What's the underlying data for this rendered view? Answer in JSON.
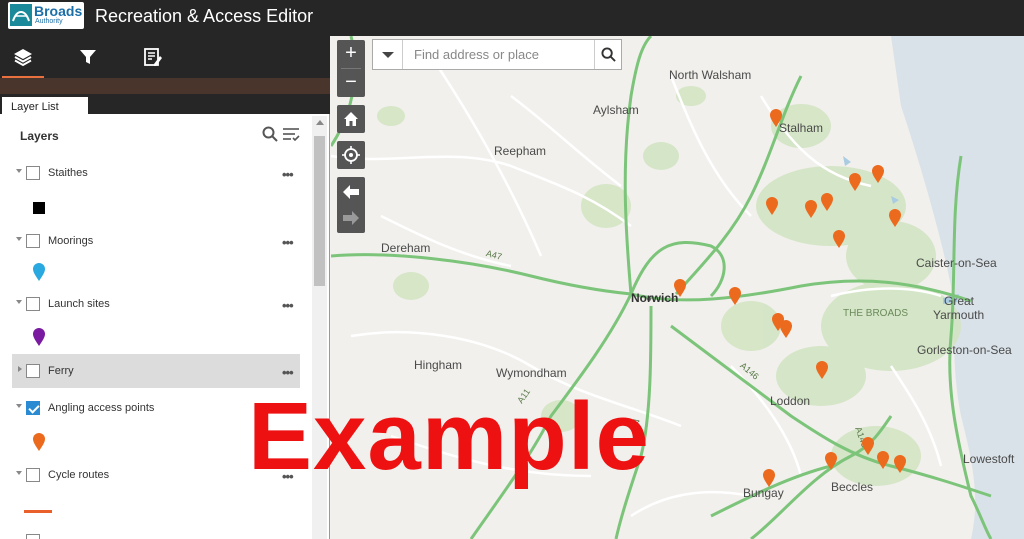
{
  "header": {
    "logo_word": "Broads",
    "logo_sub": "Authority",
    "title": "Recreation & Access Editor"
  },
  "toolbar": {
    "tools": [
      "layers-icon",
      "filter-icon",
      "edit-icon"
    ],
    "active": "layers-icon"
  },
  "panel": {
    "tab_label": "Layer List",
    "heading": "Layers",
    "layers": [
      {
        "label": "Staithes",
        "checked": false,
        "legend": "black-square"
      },
      {
        "label": "Moorings",
        "checked": false,
        "legend": "blue-pin"
      },
      {
        "label": "Launch sites",
        "checked": false,
        "legend": "purple-pin"
      },
      {
        "label": "Ferry",
        "checked": false,
        "legend": "none"
      },
      {
        "label": "Angling access points",
        "checked": true,
        "legend": "orange-pin"
      },
      {
        "label": "Cycle routes",
        "checked": false,
        "legend": "orange-line"
      }
    ]
  },
  "search": {
    "placeholder": "Find address or place"
  },
  "map": {
    "controls": [
      "zoom-in",
      "zoom-out",
      "home",
      "locate",
      "back",
      "forward"
    ],
    "zoom_in_label": "+",
    "zoom_out_label": "−",
    "places": {
      "north_walsham": "North Walsham",
      "aylsham": "Aylsham",
      "stalham": "Stalham",
      "reepham": "Reepham",
      "dereham": "Dereham",
      "caister": "Caister-on-Sea",
      "norwich": "Norwich",
      "the_broads": "THE BROADS",
      "great_yarmouth_1": "Great",
      "great_yarmouth_2": "Yarmouth",
      "gorleston": "Gorleston-on-Sea",
      "hingham": "Hingham",
      "wymondham": "Wymondham",
      "loddon": "Loddon",
      "lowestoft": "Lowestoft",
      "beccles": "Beccles",
      "bungay": "Bungay"
    },
    "road_labels": {
      "a47": "A47",
      "a11": "A11",
      "a146": "A146",
      "a140": "A140",
      "a143": "A143"
    }
  },
  "watermark": "Example",
  "colors": {
    "header_bg": "#262626",
    "accent": "#e9713f",
    "pin_orange": "#ec6a1e",
    "road_green": "#7cc47a",
    "checkbox_blue": "#2a8bd3"
  }
}
